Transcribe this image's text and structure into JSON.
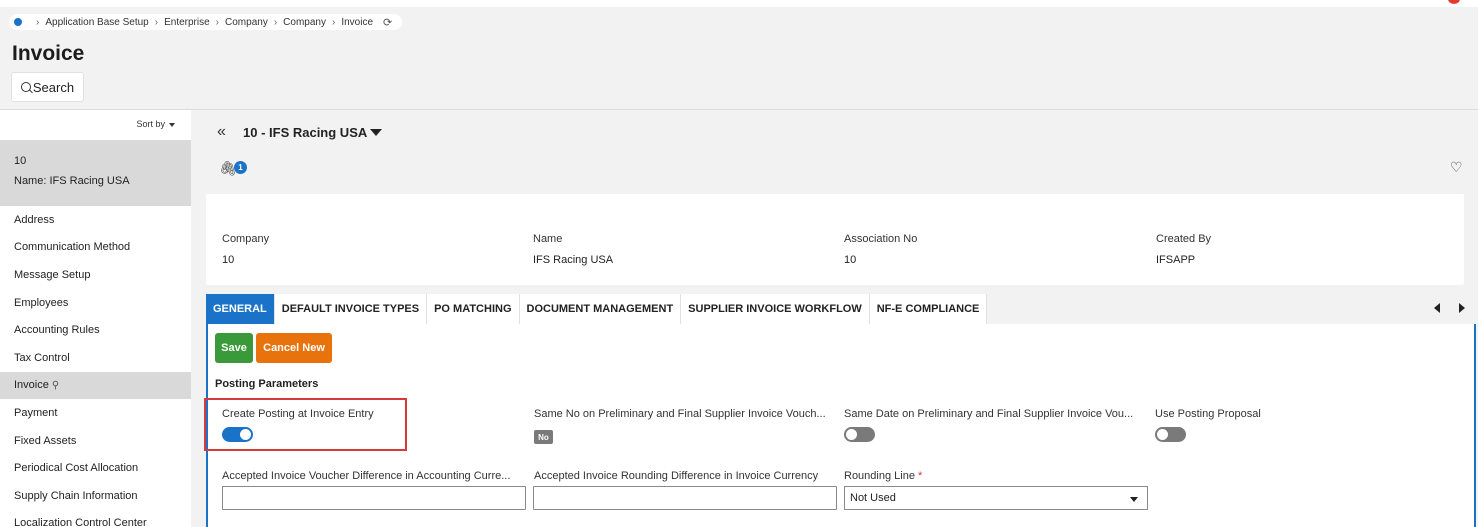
{
  "breadcrumb": [
    "Application Base Setup",
    "Enterprise",
    "Company",
    "Company",
    "Invoice"
  ],
  "page": {
    "title": "Invoice",
    "search_label": "Search"
  },
  "sidebar": {
    "sort_label": "Sort by",
    "record_id": "10",
    "record_name": "Name:  IFS Racing USA",
    "items": [
      "Address",
      "Communication Method",
      "Message Setup",
      "Employees",
      "Accounting Rules",
      "Tax Control",
      "Invoice",
      "Payment",
      "Fixed Assets",
      "Periodical Cost Allocation",
      "Supply Chain Information",
      "Localization Control Center"
    ],
    "active_index": 6
  },
  "record": {
    "title": "10 - IFS Racing USA",
    "attachment_count": "1"
  },
  "header": {
    "company_label": "Company",
    "company_value": "10",
    "name_label": "Name",
    "name_value": "IFS Racing USA",
    "assoc_label": "Association No",
    "assoc_value": "10",
    "created_label": "Created By",
    "created_value": "IFSAPP"
  },
  "tabs": [
    "GENERAL",
    "DEFAULT INVOICE TYPES",
    "PO MATCHING",
    "DOCUMENT MANAGEMENT",
    "SUPPLIER INVOICE WORKFLOW",
    "NF-E COMPLIANCE"
  ],
  "actions": {
    "save": "Save",
    "cancel": "Cancel New"
  },
  "section": "Posting Parameters",
  "fields": {
    "create_posting": "Create Posting at Invoice Entry",
    "same_no": "Same No on Preliminary and Final Supplier Invoice Vouch...",
    "same_no_value": "No",
    "same_date": "Same Date on Preliminary and Final Supplier Invoice Vou...",
    "use_proposal": "Use Posting Proposal",
    "accepted_voucher": "Accepted Invoice Voucher Difference in Accounting Curre...",
    "accepted_rounding": "Accepted Invoice Rounding Difference in Invoice Currency",
    "rounding_line": "Rounding Line",
    "rounding_required": "*",
    "rounding_value": "Not Used"
  },
  "toggles": {
    "create_posting": true,
    "same_date": false,
    "use_proposal": false
  },
  "colors": {
    "accent": "#1a73c9",
    "save": "#3a9a3a",
    "cancel": "#e8720c",
    "highlight": "#d63a3a"
  }
}
